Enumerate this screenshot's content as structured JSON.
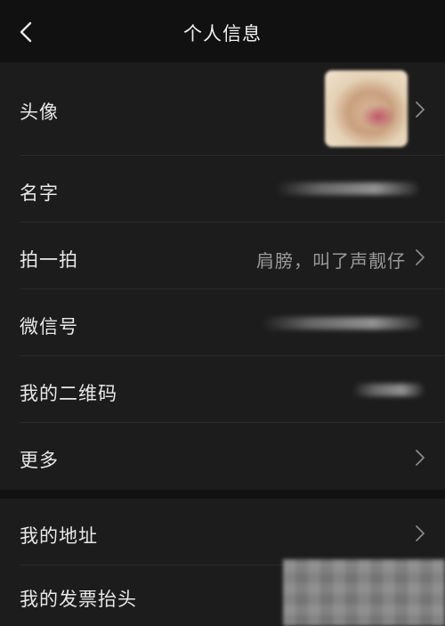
{
  "header": {
    "title": "个人信息"
  },
  "rows": [
    {
      "label": "头像"
    },
    {
      "label": "名字"
    },
    {
      "label": "拍一拍",
      "value": "肩膀，叫了声靓仔"
    },
    {
      "label": "微信号"
    },
    {
      "label": "我的二维码"
    },
    {
      "label": "更多"
    }
  ],
  "rows2": [
    {
      "label": "我的地址"
    },
    {
      "label": "我的发票抬头"
    }
  ],
  "icons": {
    "back": "back-arrow-icon",
    "chevron": "chevron-right-icon"
  },
  "colors": {
    "background": "#111111",
    "row_background": "#1c1c1c",
    "text": "#e8e8e8",
    "secondary_text": "#9a9a9a"
  }
}
